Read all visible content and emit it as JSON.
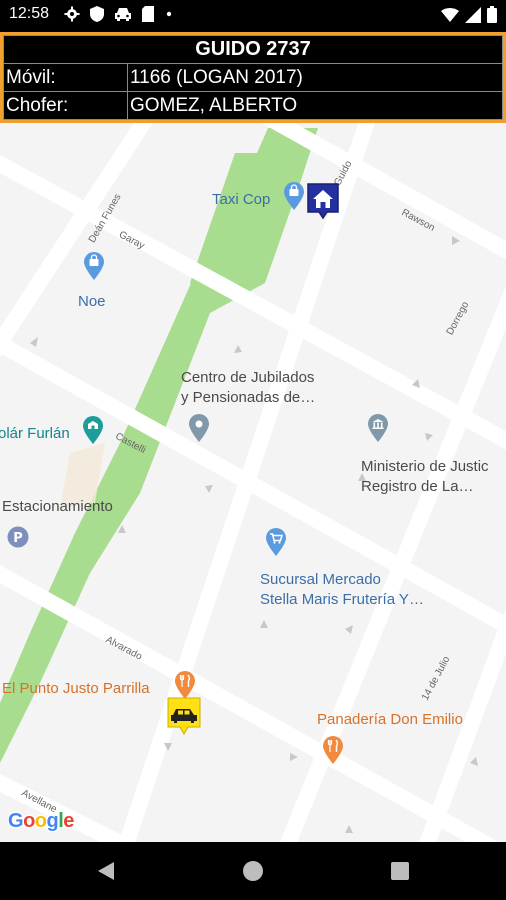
{
  "status_bar": {
    "time": "12:58",
    "icons": [
      "gear-icon",
      "shield-icon",
      "car-icon",
      "sd-card-icon",
      "dot-icon",
      "wifi-icon",
      "signal-icon",
      "battery-icon"
    ]
  },
  "info": {
    "title": "GUIDO 2737",
    "rows": [
      {
        "label": "Móvil:",
        "value": "1166 (LOGAN 2017)"
      },
      {
        "label": "Chofer:",
        "value": "GOMEZ, ALBERTO"
      }
    ],
    "accent_color": "#f0a030"
  },
  "map": {
    "places": [
      {
        "name": "Taxi Cop",
        "icon": "shopping-bag-pin-icon"
      },
      {
        "name": "Noe",
        "icon": "shopping-bag-pin-icon"
      },
      {
        "name": "Centro de Jubilados\ny Pensionadas de…",
        "line1": "Centro de Jubilados",
        "line2": "y Pensionadas de…",
        "icon": "location-pin-icon"
      },
      {
        "name": "olár Furlán",
        "icon": "school-pin-icon"
      },
      {
        "name": "Ministerio de Justic",
        "line1": "Ministerio de Justic",
        "line2": "Registro de La…",
        "icon": "government-pin-icon"
      },
      {
        "name": "Estacionamiento",
        "icon": "parking-icon"
      },
      {
        "name": "Sucursal Mercado",
        "line1": "Sucursal Mercado",
        "line2": "Stella Maris Frutería Y…",
        "icon": "shopping-cart-pin-icon"
      },
      {
        "name": "El Punto Justo Parrilla",
        "icon": "restaurant-pin-icon"
      },
      {
        "name": "Panadería Don Emilio",
        "icon": "restaurant-pin-icon"
      }
    ],
    "streets": [
      "Guido",
      "Rawson",
      "Deán Funes",
      "Garay",
      "Dorrego",
      "Castelli",
      "Alvarado",
      "14 de Julio",
      "Avellane"
    ],
    "markers": [
      "home-marker",
      "taxi-marker"
    ],
    "attribution": "Google"
  },
  "nav_bar": {
    "buttons": [
      "back-icon",
      "home-icon",
      "recents-icon"
    ]
  }
}
